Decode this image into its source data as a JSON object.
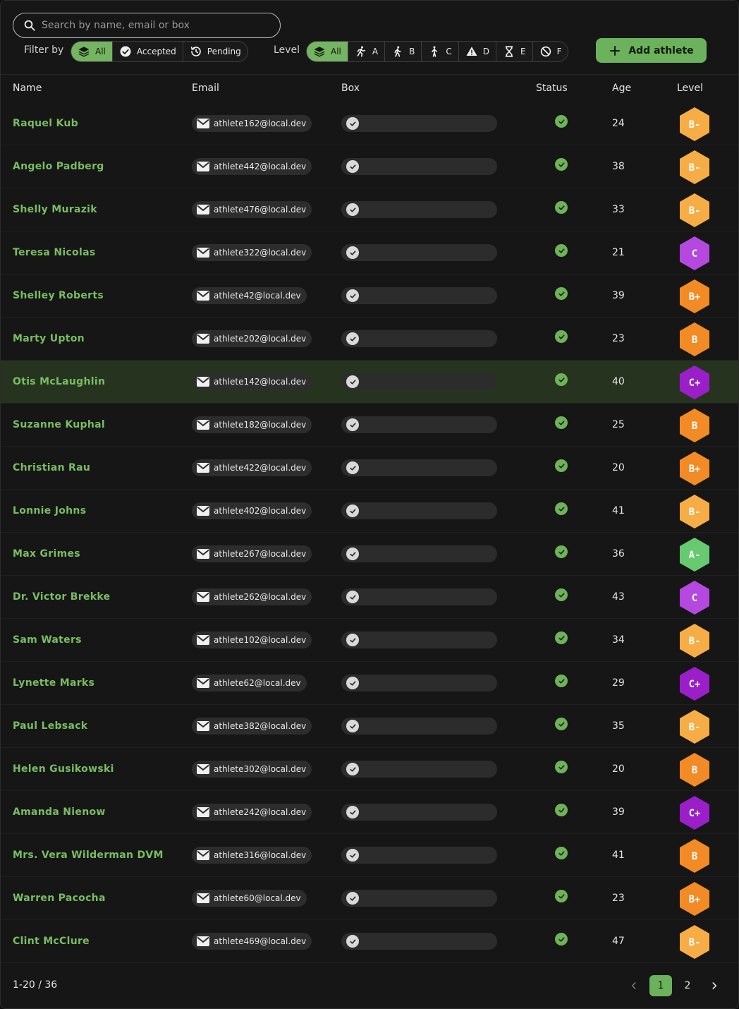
{
  "search": {
    "placeholder": "Search by name, email or box"
  },
  "filter": {
    "label": "Filter by",
    "options": [
      {
        "label": "All",
        "icon": "layers-icon",
        "active": true
      },
      {
        "label": "Accepted",
        "icon": "check-circle-icon",
        "active": false
      },
      {
        "label": "Pending",
        "icon": "history-icon",
        "active": false
      }
    ]
  },
  "level_filter": {
    "label": "Level",
    "options": [
      {
        "label": "All",
        "icon": "layers-icon",
        "active": true
      },
      {
        "label": "A",
        "icon": "running-icon",
        "active": false
      },
      {
        "label": "B",
        "icon": "walking-icon",
        "active": false
      },
      {
        "label": "C",
        "icon": "standing-person-icon",
        "active": false
      },
      {
        "label": "D",
        "icon": "warning-icon",
        "active": false
      },
      {
        "label": "E",
        "icon": "hourglass-icon",
        "active": false
      },
      {
        "label": "F",
        "icon": "forbidden-icon",
        "active": false
      }
    ]
  },
  "add_button": {
    "label": "Add athlete",
    "icon": "plus-icon"
  },
  "columns": {
    "name": "Name",
    "email": "Email",
    "box": "Box",
    "status": "Status",
    "age": "Age",
    "level": "Level"
  },
  "level_colors": {
    "B-": "#f7ad45",
    "B": "#f28a25",
    "B+": "#f28a25",
    "C": "#b548de",
    "C+": "#9a1fc8",
    "A-": "#67c970"
  },
  "rows": [
    {
      "name": "Raquel Kub",
      "email": "athlete162@local.dev",
      "age": "24",
      "level": "B-",
      "highlight": false
    },
    {
      "name": "Angelo Padberg",
      "email": "athlete442@local.dev",
      "age": "38",
      "level": "B-",
      "highlight": false
    },
    {
      "name": "Shelly Murazik",
      "email": "athlete476@local.dev",
      "age": "33",
      "level": "B-",
      "highlight": false
    },
    {
      "name": "Teresa Nicolas",
      "email": "athlete322@local.dev",
      "age": "21",
      "level": "C",
      "highlight": false
    },
    {
      "name": "Shelley Roberts",
      "email": "athlete42@local.dev",
      "age": "39",
      "level": "B+",
      "highlight": false
    },
    {
      "name": "Marty Upton",
      "email": "athlete202@local.dev",
      "age": "23",
      "level": "B",
      "highlight": false
    },
    {
      "name": "Otis McLaughlin",
      "email": "athlete142@local.dev",
      "age": "40",
      "level": "C+",
      "highlight": true
    },
    {
      "name": "Suzanne Kuphal",
      "email": "athlete182@local.dev",
      "age": "25",
      "level": "B",
      "highlight": false
    },
    {
      "name": "Christian Rau",
      "email": "athlete422@local.dev",
      "age": "20",
      "level": "B+",
      "highlight": false
    },
    {
      "name": "Lonnie Johns",
      "email": "athlete402@local.dev",
      "age": "41",
      "level": "B-",
      "highlight": false
    },
    {
      "name": "Max Grimes",
      "email": "athlete267@local.dev",
      "age": "36",
      "level": "A-",
      "highlight": false
    },
    {
      "name": "Dr. Victor Brekke",
      "email": "athlete262@local.dev",
      "age": "43",
      "level": "C",
      "highlight": false
    },
    {
      "name": "Sam Waters",
      "email": "athlete102@local.dev",
      "age": "34",
      "level": "B-",
      "highlight": false
    },
    {
      "name": "Lynette Marks",
      "email": "athlete62@local.dev",
      "age": "29",
      "level": "C+",
      "highlight": false
    },
    {
      "name": "Paul Lebsack",
      "email": "athlete382@local.dev",
      "age": "35",
      "level": "B-",
      "highlight": false
    },
    {
      "name": "Helen Gusikowski",
      "email": "athlete302@local.dev",
      "age": "20",
      "level": "B",
      "highlight": false
    },
    {
      "name": "Amanda Nienow",
      "email": "athlete242@local.dev",
      "age": "39",
      "level": "C+",
      "highlight": false
    },
    {
      "name": "Mrs. Vera Wilderman DVM",
      "email": "athlete316@local.dev",
      "age": "41",
      "level": "B",
      "highlight": false
    },
    {
      "name": "Warren Pacocha",
      "email": "athlete60@local.dev",
      "age": "23",
      "level": "B+",
      "highlight": false
    },
    {
      "name": "Clint McClure",
      "email": "athlete469@local.dev",
      "age": "47",
      "level": "B-",
      "highlight": false
    }
  ],
  "pagination": {
    "range": "1-20 / 36",
    "pages": [
      "1",
      "2"
    ],
    "current": "1"
  }
}
